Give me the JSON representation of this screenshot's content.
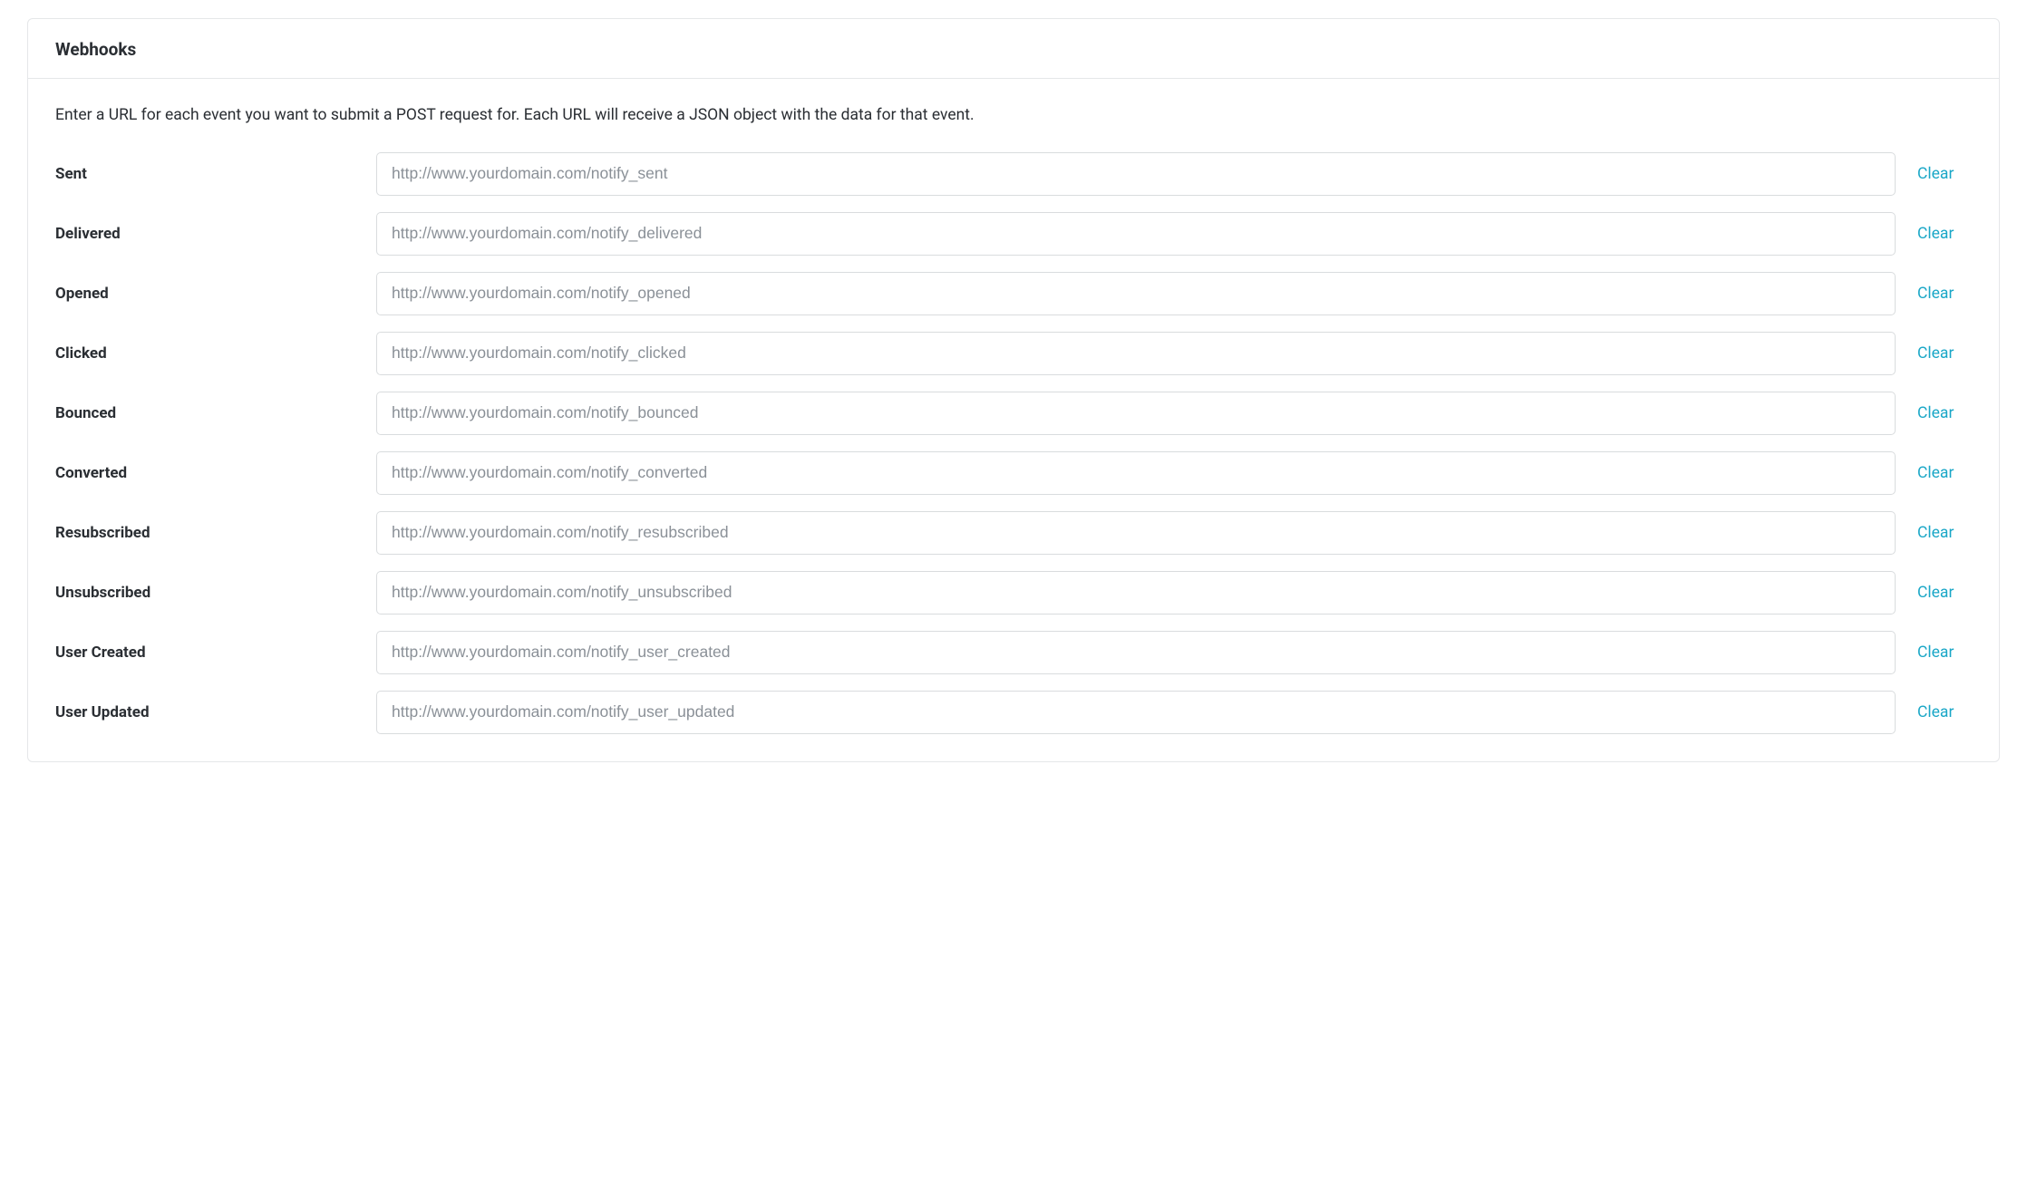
{
  "panel": {
    "title": "Webhooks",
    "description": "Enter a URL for each event you want to submit a POST request for. Each URL will receive a JSON object with the data for that event."
  },
  "clear_label": "Clear",
  "events": [
    {
      "key": "sent",
      "label": "Sent",
      "placeholder": "http://www.yourdomain.com/notify_sent",
      "value": ""
    },
    {
      "key": "delivered",
      "label": "Delivered",
      "placeholder": "http://www.yourdomain.com/notify_delivered",
      "value": ""
    },
    {
      "key": "opened",
      "label": "Opened",
      "placeholder": "http://www.yourdomain.com/notify_opened",
      "value": ""
    },
    {
      "key": "clicked",
      "label": "Clicked",
      "placeholder": "http://www.yourdomain.com/notify_clicked",
      "value": ""
    },
    {
      "key": "bounced",
      "label": "Bounced",
      "placeholder": "http://www.yourdomain.com/notify_bounced",
      "value": ""
    },
    {
      "key": "converted",
      "label": "Converted",
      "placeholder": "http://www.yourdomain.com/notify_converted",
      "value": ""
    },
    {
      "key": "resubscribed",
      "label": "Resubscribed",
      "placeholder": "http://www.yourdomain.com/notify_resubscribed",
      "value": ""
    },
    {
      "key": "unsubscribed",
      "label": "Unsubscribed",
      "placeholder": "http://www.yourdomain.com/notify_unsubscribed",
      "value": ""
    },
    {
      "key": "user-created",
      "label": "User Created",
      "placeholder": "http://www.yourdomain.com/notify_user_created",
      "value": ""
    },
    {
      "key": "user-updated",
      "label": "User Updated",
      "placeholder": "http://www.yourdomain.com/notify_user_updated",
      "value": ""
    }
  ]
}
